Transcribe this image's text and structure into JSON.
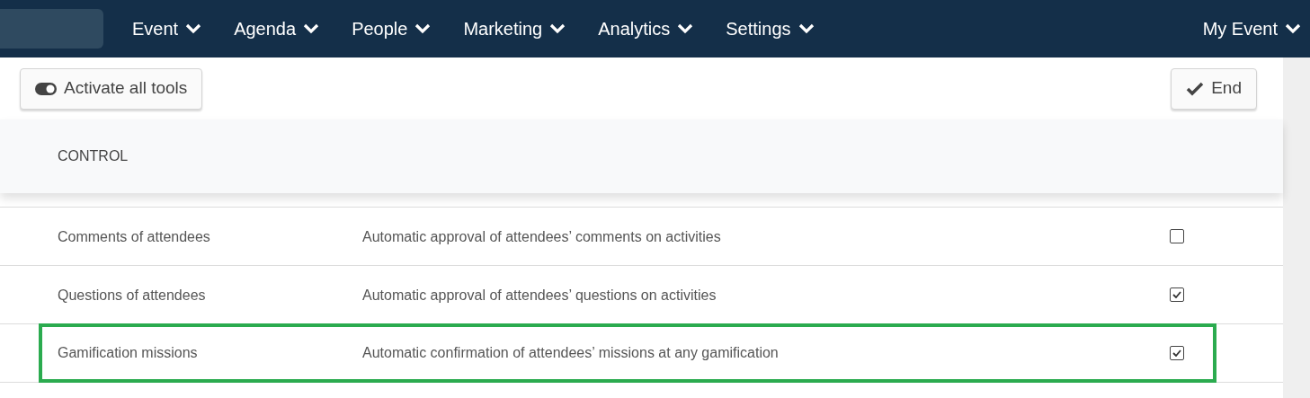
{
  "nav": {
    "menus": [
      {
        "label": "Event"
      },
      {
        "label": "Agenda"
      },
      {
        "label": "People"
      },
      {
        "label": "Marketing"
      },
      {
        "label": "Analytics"
      },
      {
        "label": "Settings"
      }
    ],
    "account": "My Event"
  },
  "toolbar": {
    "activate_button": "Activate all tools",
    "end_button": "End"
  },
  "section_title": "CONTROL",
  "rows": [
    {
      "name": "Comments of attendees",
      "description": "Automatic approval of attendees’ comments on activities",
      "checked": false,
      "highlighted": false
    },
    {
      "name": "Questions of attendees",
      "description": "Automatic approval of attendees’ questions on activities",
      "checked": true,
      "highlighted": false
    },
    {
      "name": "Gamification missions",
      "description": "Automatic confirmation of attendees’ missions at any gamification",
      "checked": true,
      "highlighted": true
    }
  ]
}
